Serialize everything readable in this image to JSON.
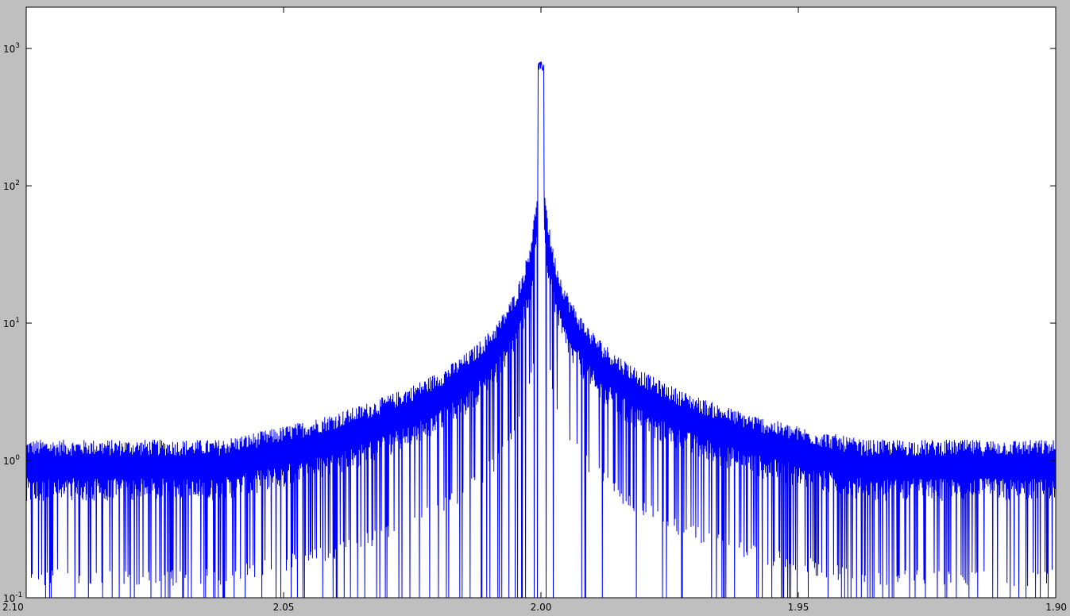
{
  "chart_data": {
    "type": "line",
    "title": "",
    "xlabel": "",
    "ylabel": "",
    "x_axis": {
      "range": [
        2.1,
        1.9
      ],
      "reversed": true,
      "ticks": [
        {
          "value": 2.1,
          "label": "2.10"
        },
        {
          "value": 2.05,
          "label": "2.05"
        },
        {
          "value": 2.0,
          "label": "2.00"
        },
        {
          "value": 1.95,
          "label": "1.95"
        },
        {
          "value": 1.9,
          "label": "1.90"
        }
      ]
    },
    "y_axis": {
      "scale": "log",
      "range": [
        0.1,
        2000
      ],
      "ticks": [
        {
          "value": 0.1,
          "base": "10",
          "exp": "-1"
        },
        {
          "value": 1,
          "base": "10",
          "exp": "0"
        },
        {
          "value": 10,
          "base": "10",
          "exp": "1"
        },
        {
          "value": 100,
          "base": "10",
          "exp": "2"
        },
        {
          "value": 1000,
          "base": "10",
          "exp": "3"
        }
      ]
    },
    "grid": false,
    "legend": "none",
    "series": [
      {
        "color": "#0000ff",
        "peak_x": 2.0,
        "peak_y": 800,
        "x_start": 2.1,
        "x_end": 1.9,
        "sample_points": [
          {
            "x": 2.1,
            "y": 1.5
          },
          {
            "x": 2.07,
            "y": 2.2
          },
          {
            "x": 2.05,
            "y": 3.0
          },
          {
            "x": 2.03,
            "y": 5.0
          },
          {
            "x": 2.02,
            "y": 8.0
          },
          {
            "x": 2.01,
            "y": 20
          },
          {
            "x": 2.005,
            "y": 50
          },
          {
            "x": 2.0,
            "y": 800
          },
          {
            "x": 1.995,
            "y": 50
          },
          {
            "x": 1.99,
            "y": 20
          },
          {
            "x": 1.98,
            "y": 8.0
          },
          {
            "x": 1.97,
            "y": 5.0
          },
          {
            "x": 1.95,
            "y": 3.0
          },
          {
            "x": 1.93,
            "y": 2.2
          },
          {
            "x": 1.9,
            "y": 1.5
          }
        ]
      }
    ]
  }
}
